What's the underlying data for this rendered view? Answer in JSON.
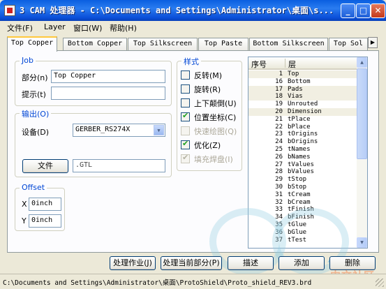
{
  "window": {
    "title": "3 CAM 处理器 - C:\\Documents and Settings\\Administrator\\桌面\\s..."
  },
  "menu": [
    "文件(F)",
    "Layer",
    "窗口(W)",
    "帮助(H)"
  ],
  "tabs": [
    "Top Copper",
    "Bottom Copper",
    "Top Silkscreen",
    "Top Paste",
    "Bottom Silkscreen",
    "Top Sol"
  ],
  "job": {
    "group_title": "Job",
    "section_label": "部分(n)",
    "section_value": "Top Copper",
    "prompt_label": "提示(t)",
    "prompt_value": ""
  },
  "output": {
    "group_title": "输出(O)",
    "device_label": "设备(D)",
    "device_value": "GERBER_RS274X",
    "file_button": "文件",
    "file_value": ".GTL"
  },
  "offset": {
    "group_title": "Offset",
    "x_label": "X",
    "x_value": "0inch",
    "y_label": "Y",
    "y_value": "0inch"
  },
  "style": {
    "group_title": "样式",
    "options": [
      {
        "label": "反转(M)",
        "checked": false,
        "enabled": true
      },
      {
        "label": "旋转(R)",
        "checked": false,
        "enabled": true
      },
      {
        "label": "上下颠倒(U)",
        "checked": false,
        "enabled": true
      },
      {
        "label": "位置坐标(C)",
        "checked": true,
        "enabled": true
      },
      {
        "label": "快速绘图(Q)",
        "checked": false,
        "enabled": false
      },
      {
        "label": "优化(Z)",
        "checked": true,
        "enabled": true
      },
      {
        "label": "填充焊盘(I)",
        "checked": true,
        "enabled": false
      }
    ]
  },
  "layers": {
    "col_number": "序号",
    "col_layer": "层",
    "rows": [
      {
        "num": "1",
        "name": "Top",
        "selected": true
      },
      {
        "num": "16",
        "name": "Bottom",
        "selected": false
      },
      {
        "num": "17",
        "name": "Pads",
        "selected": true
      },
      {
        "num": "18",
        "name": "Vias",
        "selected": true
      },
      {
        "num": "19",
        "name": "Unrouted",
        "selected": false
      },
      {
        "num": "20",
        "name": "Dimension",
        "selected": true
      },
      {
        "num": "21",
        "name": "tPlace",
        "selected": false
      },
      {
        "num": "22",
        "name": "bPlace",
        "selected": false
      },
      {
        "num": "23",
        "name": "tOrigins",
        "selected": false
      },
      {
        "num": "24",
        "name": "bOrigins",
        "selected": false
      },
      {
        "num": "25",
        "name": "tNames",
        "selected": false
      },
      {
        "num": "26",
        "name": "bNames",
        "selected": false
      },
      {
        "num": "27",
        "name": "tValues",
        "selected": false
      },
      {
        "num": "28",
        "name": "bValues",
        "selected": false
      },
      {
        "num": "29",
        "name": "tStop",
        "selected": false
      },
      {
        "num": "30",
        "name": "bStop",
        "selected": false
      },
      {
        "num": "31",
        "name": "tCream",
        "selected": false
      },
      {
        "num": "32",
        "name": "bCream",
        "selected": false
      },
      {
        "num": "33",
        "name": "tFinish",
        "selected": false
      },
      {
        "num": "34",
        "name": "bFinish",
        "selected": false
      },
      {
        "num": "35",
        "name": "tGlue",
        "selected": false
      },
      {
        "num": "36",
        "name": "bGlue",
        "selected": false
      },
      {
        "num": "37",
        "name": "tTest",
        "selected": false
      }
    ]
  },
  "buttons": {
    "process_job": "处理作业(J)",
    "process_section": "处理当前部分(P)",
    "describe": "描述",
    "add": "添加",
    "delete": "删除"
  },
  "status": {
    "path": "C:\\Documents and Settings\\Administrator\\桌面\\ProtoShield\\Proto_shield_REV3.brd"
  },
  "watermark": {
    "brand": "ARDUINO",
    "text": "中文社区"
  }
}
